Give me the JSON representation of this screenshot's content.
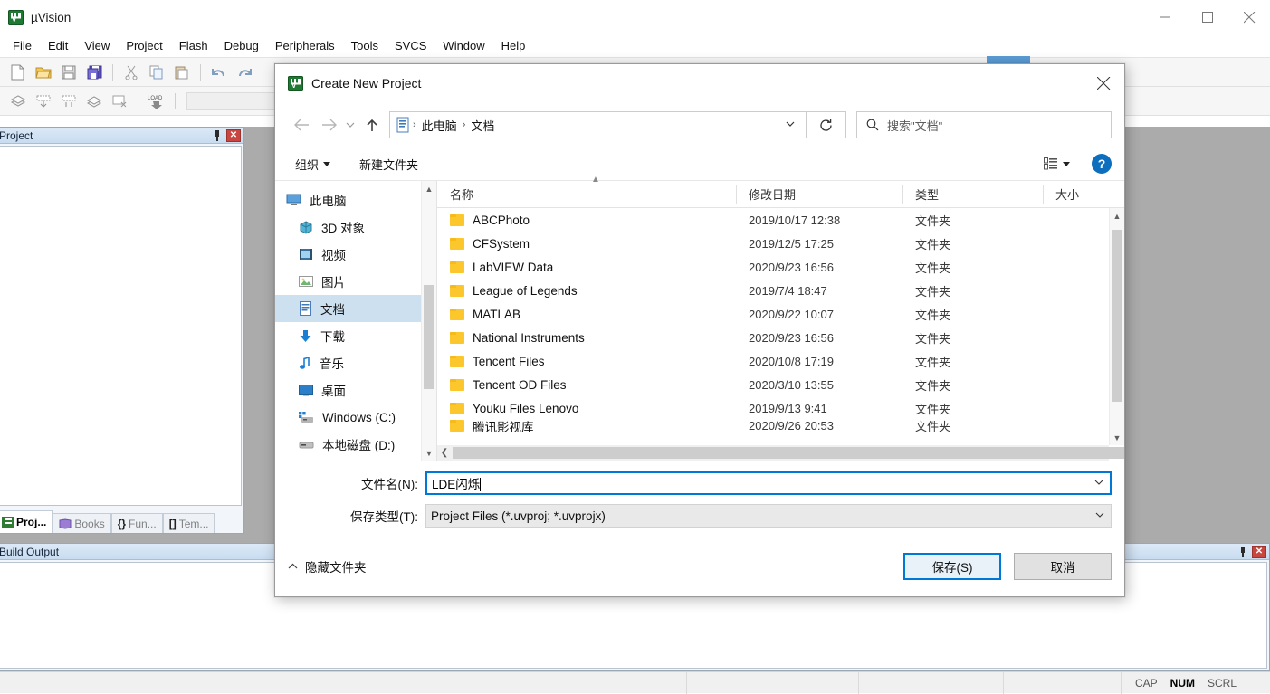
{
  "app": {
    "title": "µVision",
    "icon": "uvision-logo-icon",
    "window_controls": {
      "minimize": "minimize-icon",
      "maximize": "maximize-icon",
      "close": "close-icon"
    }
  },
  "menubar": {
    "items": [
      "File",
      "Edit",
      "View",
      "Project",
      "Flash",
      "Debug",
      "Peripherals",
      "Tools",
      "SVCS",
      "Window",
      "Help"
    ]
  },
  "toolbar": {
    "row1": [
      "new-file-icon",
      "open-file-icon",
      "save-icon",
      "save-all-icon",
      "cut-icon",
      "copy-icon",
      "paste-icon",
      "undo-icon",
      "redo-icon"
    ],
    "row2": [
      "build-icon",
      "rebuild-icon",
      "batch-build-icon",
      "translate-icon",
      "stop-build-icon",
      "load-icon"
    ],
    "target_combo_value": ""
  },
  "project_panel": {
    "title": "Project",
    "pin": "pin-icon",
    "close": "close-icon",
    "tabs": [
      {
        "label": "Proj...",
        "icon": "project-icon",
        "active": true
      },
      {
        "label": "Books",
        "icon": "books-icon",
        "active": false
      },
      {
        "label": "Fun...",
        "icon": "functions-icon",
        "active": false
      },
      {
        "label": "Tem...",
        "icon": "templates-icon",
        "active": false
      }
    ]
  },
  "build_panel": {
    "title": "Build Output",
    "pin": "pin-icon",
    "close": "close-icon",
    "content": ""
  },
  "statusbar": {
    "message": "",
    "indicators": [
      {
        "label": "CAP",
        "active": false
      },
      {
        "label": "NUM",
        "active": true
      },
      {
        "label": "SCRL",
        "active": false
      }
    ]
  },
  "dialog": {
    "title": "Create New Project",
    "icon": "uvision-logo-icon",
    "close": "close-icon",
    "nav": {
      "back": "arrow-left-icon",
      "forward": "arrow-right-icon",
      "recent": "chevron-down-icon",
      "up": "arrow-up-icon",
      "breadcrumb_icon": "documents-icon",
      "breadcrumb": [
        "此电脑",
        "文档"
      ],
      "breadcrumb_caret": "chevron-down-icon",
      "refresh": "refresh-icon",
      "search_icon": "search-icon",
      "search_placeholder": "搜索\"文档\""
    },
    "toolbar": {
      "organize": "组织",
      "new_folder": "新建文件夹",
      "view_mode_icon": "view-mode-icon",
      "view_mode_caret": "chevron-down-icon",
      "help": "?"
    },
    "tree": [
      {
        "label": "此电脑",
        "icon": "this-pc-icon",
        "level": 0,
        "selected": false
      },
      {
        "label": "3D 对象",
        "icon": "3d-objects-icon",
        "level": 1,
        "selected": false
      },
      {
        "label": "视频",
        "icon": "videos-icon",
        "level": 1,
        "selected": false
      },
      {
        "label": "图片",
        "icon": "pictures-icon",
        "level": 1,
        "selected": false
      },
      {
        "label": "文档",
        "icon": "documents-icon",
        "level": 1,
        "selected": true
      },
      {
        "label": "下载",
        "icon": "downloads-icon",
        "level": 1,
        "selected": false
      },
      {
        "label": "音乐",
        "icon": "music-icon",
        "level": 1,
        "selected": false
      },
      {
        "label": "桌面",
        "icon": "desktop-icon",
        "level": 1,
        "selected": false
      },
      {
        "label": "Windows (C:)",
        "icon": "windows-drive-icon",
        "level": 1,
        "selected": false
      },
      {
        "label": "本地磁盘 (D:)",
        "icon": "drive-icon",
        "level": 1,
        "selected": false
      }
    ],
    "columns": [
      "名称",
      "修改日期",
      "类型",
      "大小"
    ],
    "files": [
      {
        "name": "ABCPhoto",
        "date": "2019/10/17 12:38",
        "type": "文件夹",
        "size": ""
      },
      {
        "name": "CFSystem",
        "date": "2019/12/5 17:25",
        "type": "文件夹",
        "size": ""
      },
      {
        "name": "LabVIEW Data",
        "date": "2020/9/23 16:56",
        "type": "文件夹",
        "size": ""
      },
      {
        "name": "League of Legends",
        "date": "2019/7/4 18:47",
        "type": "文件夹",
        "size": ""
      },
      {
        "name": "MATLAB",
        "date": "2020/9/22 10:07",
        "type": "文件夹",
        "size": ""
      },
      {
        "name": "National Instruments",
        "date": "2020/9/23 16:56",
        "type": "文件夹",
        "size": ""
      },
      {
        "name": "Tencent Files",
        "date": "2020/10/8 17:19",
        "type": "文件夹",
        "size": ""
      },
      {
        "name": "Tencent OD Files",
        "date": "2020/3/10 13:55",
        "type": "文件夹",
        "size": ""
      },
      {
        "name": "Youku Files Lenovo",
        "date": "2019/9/13 9:41",
        "type": "文件夹",
        "size": ""
      },
      {
        "name": "腾讯影视库",
        "date": "2020/9/26 20:53",
        "type": "文件夹",
        "size": ""
      }
    ],
    "form": {
      "filename_label": "文件名(N):",
      "filename_value": "LDE闪烁",
      "filetype_label": "保存类型(T):",
      "filetype_value": "Project Files (*.uvproj; *.uvprojx)"
    },
    "footer": {
      "hide_folders": "隐藏文件夹",
      "hide_folders_caret": "chevron-up-icon",
      "save": "保存(S)",
      "cancel": "取消"
    }
  },
  "colors": {
    "accent": "#0078d7",
    "selection": "#cce0f0",
    "folder": "#fcc72c",
    "mdi_bg": "#ababab"
  }
}
